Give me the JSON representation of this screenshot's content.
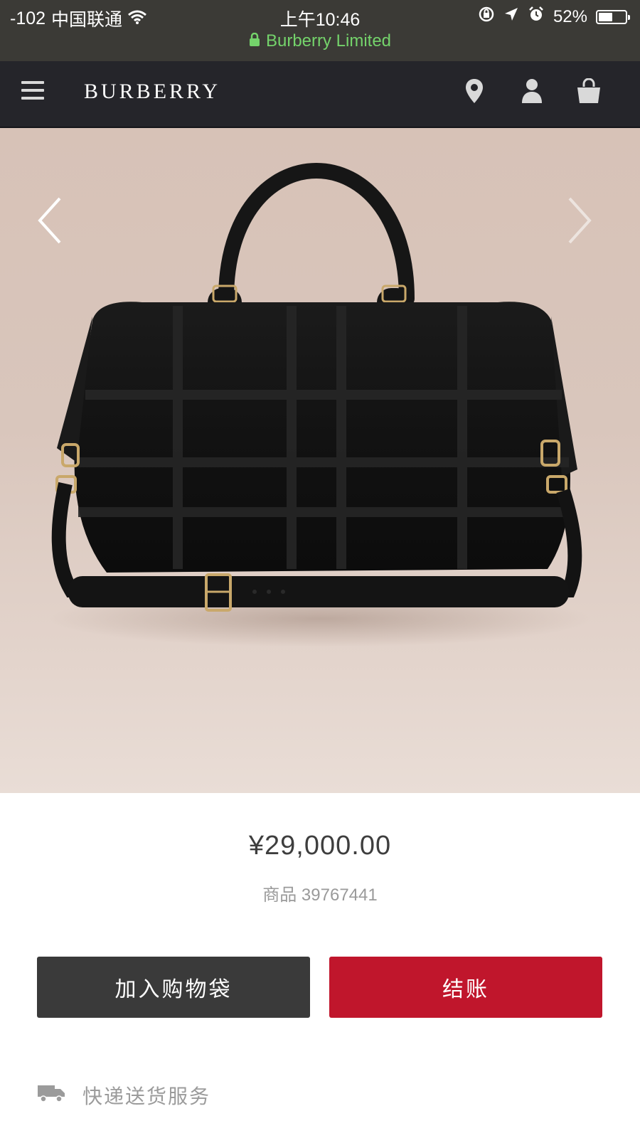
{
  "status_bar": {
    "signal": "-102",
    "carrier": "中国联通",
    "time": "上午10:46",
    "battery": "52%",
    "battery_level": 0.52,
    "page_title": "Burberry Limited"
  },
  "header": {
    "brand": "BURBERRY",
    "icons": [
      "menu-icon",
      "location-pin-icon",
      "account-icon",
      "shopping-bag-icon"
    ]
  },
  "product": {
    "price": "¥29,000.00",
    "sku": "商品 39767441",
    "add_to_bag_label": "加入购物袋",
    "checkout_label": "结账",
    "delivery_label": "快递送货服务"
  },
  "colors": {
    "status_bar_bg": "#3b3a36",
    "header_bg": "#25252a",
    "secure_green": "#74d36b",
    "checkout_red": "#c0162c",
    "add_button_gray": "#3a3a3a"
  }
}
